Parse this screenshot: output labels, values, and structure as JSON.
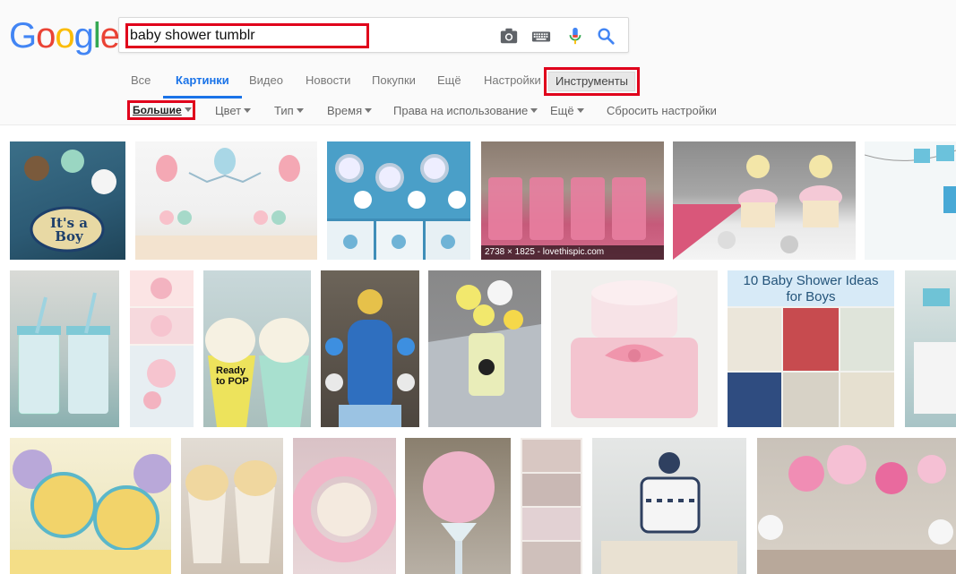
{
  "logo": {
    "text": "Google",
    "letters": [
      "G",
      "o",
      "o",
      "g",
      "l",
      "e"
    ],
    "colors": [
      "#4285f4",
      "#ea4335",
      "#fbbc05",
      "#4285f4",
      "#34a853",
      "#ea4335"
    ]
  },
  "search": {
    "query": "baby shower tumblr",
    "icons": [
      "camera-icon",
      "keyboard-icon",
      "microphone-icon",
      "search-icon"
    ]
  },
  "tabs": [
    {
      "label": "Все",
      "active": false
    },
    {
      "label": "Картинки",
      "active": true
    },
    {
      "label": "Видео",
      "active": false
    },
    {
      "label": "Новости",
      "active": false
    },
    {
      "label": "Покупки",
      "active": false
    },
    {
      "label": "Ещё",
      "active": false
    },
    {
      "label": "Настройки",
      "active": false
    }
  ],
  "tools_label": "Инструменты",
  "filters": {
    "size": "Большие",
    "color": "Цвет",
    "type": "Тип",
    "time": "Время",
    "rights": "Права на использование",
    "more": "Ещё",
    "reset": "Сбросить настройки"
  },
  "results": {
    "hover_caption": "2738 × 1825 - lovethispic.com",
    "boy_sign": "It's a Boy",
    "ideas_title_line1": "10 Baby Shower Ideas",
    "ideas_title_line2": "for Boys",
    "popcorn_sign": "Ready to POP"
  },
  "colors": {
    "accent": "#1a73e8",
    "highlight": "#e0001b"
  }
}
